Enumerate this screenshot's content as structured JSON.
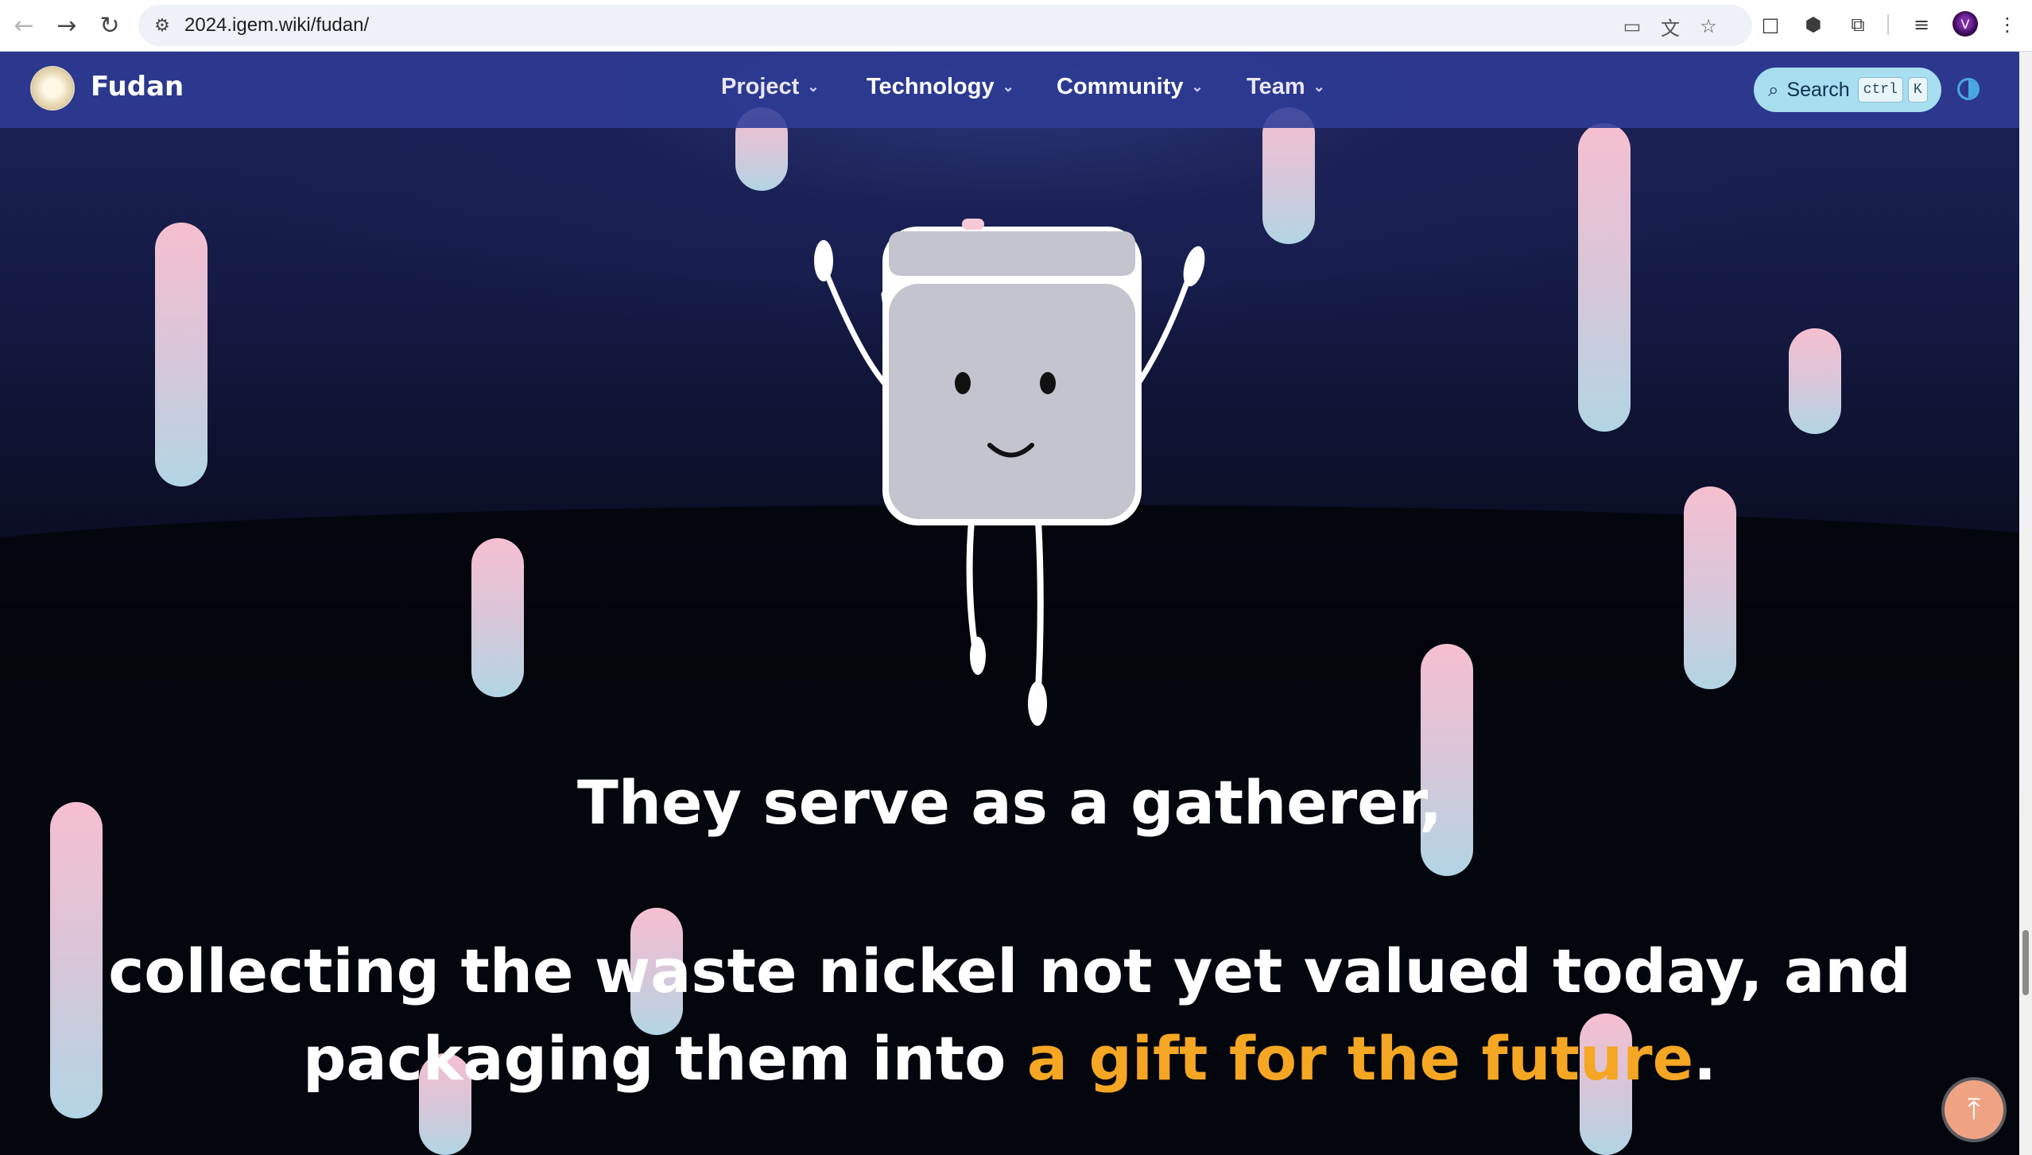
{
  "browser": {
    "url": "2024.igem.wiki/fudan/",
    "icons": [
      "back-icon",
      "forward-icon",
      "reload-icon",
      "site-info-icon",
      "cast-icon",
      "translate-icon",
      "bookmark-star-icon",
      "extension-icon",
      "puzzle-icon",
      "tab-search-icon",
      "profile-avatar",
      "more-menu-icon"
    ]
  },
  "site": {
    "brand": "Fudan",
    "menu": [
      {
        "label": "Project"
      },
      {
        "label": "Technology"
      },
      {
        "label": "Community"
      },
      {
        "label": "Team"
      }
    ],
    "search": {
      "label": "Search",
      "key1": "ctrl",
      "key2": "K"
    }
  },
  "hero": {
    "line1": "They serve as a gatherer,",
    "line2": "collecting the waste nickel not yet valued today, and",
    "line3_prefix": "packaging them into ",
    "line3_highlight": "a gift for the future",
    "line3_suffix": "."
  },
  "colors": {
    "header_bg": "#2e3b96",
    "highlight": "#f5a623",
    "search_bg": "#a7def0",
    "to_top_button": "#f0a383"
  }
}
